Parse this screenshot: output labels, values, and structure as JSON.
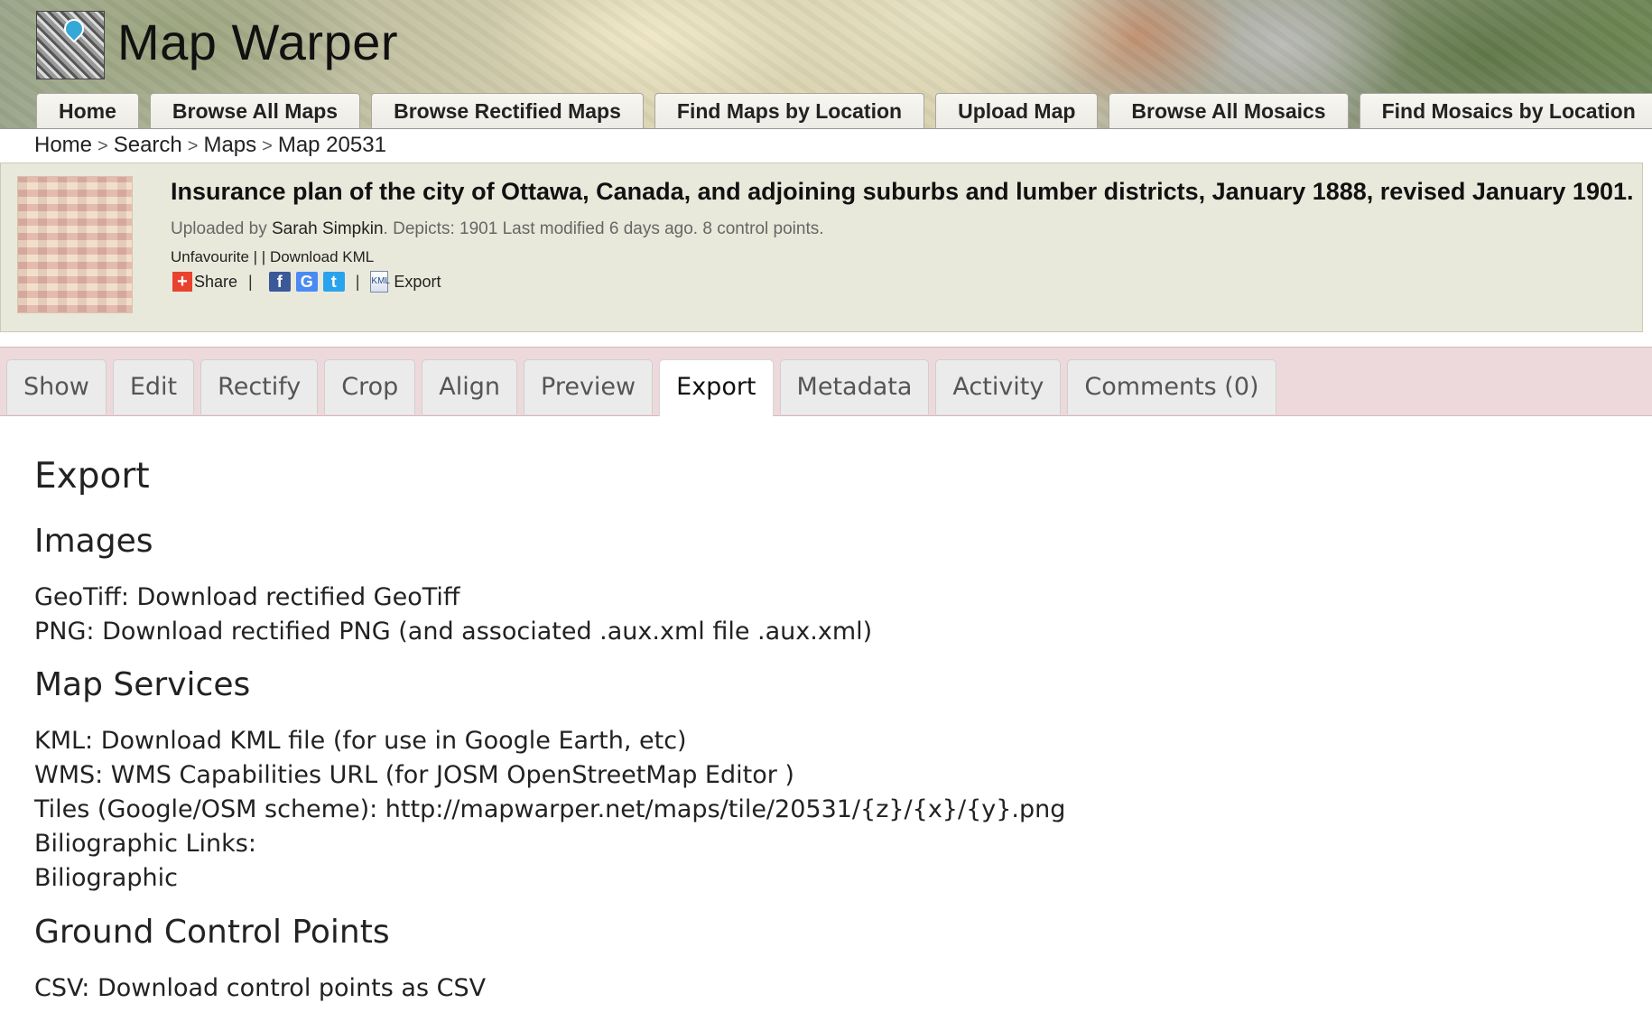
{
  "header": {
    "site_title": "Map Warper",
    "nav": [
      "Home",
      "Browse All Maps",
      "Browse Rectified Maps",
      "Find Maps by Location",
      "Upload Map",
      "Browse All Mosaics",
      "Find Mosaics by Location"
    ]
  },
  "breadcrumb": [
    "Home",
    "Search",
    "Maps",
    "Map 20531"
  ],
  "map": {
    "title": "Insurance plan of the city of Ottawa, Canada, and adjoining suburbs and lumber districts, January 1888, revised January 1901.",
    "uploaded_prefix": "Uploaded by",
    "uploader": "Sarah Simpkin",
    "meta_rest": ". Depicts: 1901 Last modified 6 days ago. 8 control points.",
    "unfavourite": "Unfavourite",
    "download_kml": "Download KML",
    "share": "Share",
    "export": "Export"
  },
  "tabs": [
    "Show",
    "Edit",
    "Rectify",
    "Crop",
    "Align",
    "Preview",
    "Export",
    "Metadata",
    "Activity",
    "Comments (0)"
  ],
  "active_tab": "Export",
  "content": {
    "title": "Export",
    "images": {
      "heading": "Images",
      "lines": [
        "GeoTiff: Download rectified GeoTiff",
        "PNG: Download rectified PNG (and associated .aux.xml file .aux.xml)"
      ]
    },
    "map_services": {
      "heading": "Map Services",
      "lines": [
        "KML: Download KML file (for use in Google Earth, etc)",
        "WMS: WMS Capabilities URL (for JOSM OpenStreetMap Editor )",
        "Tiles (Google/OSM scheme): http://mapwarper.net/maps/tile/20531/{z}/{x}/{y}.png",
        "Biliographic Links:",
        "Biliographic"
      ]
    },
    "gcp": {
      "heading": "Ground Control Points",
      "lines": [
        "CSV: Download control points as CSV"
      ]
    }
  }
}
